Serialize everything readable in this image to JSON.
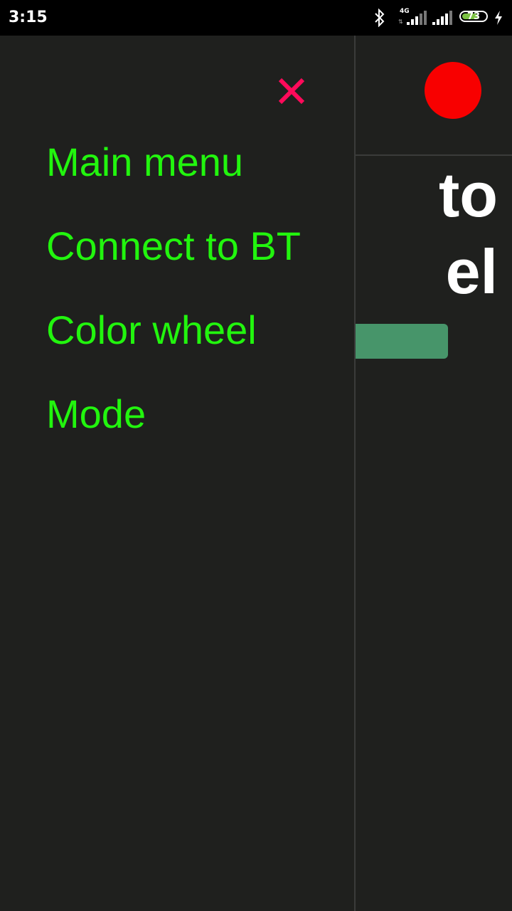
{
  "status_bar": {
    "time": "3:15",
    "network": "4G",
    "battery": "73",
    "battery_level_percent": 73,
    "battery_color": "#7cc243",
    "icons": [
      "bluetooth-icon",
      "signal-icon",
      "signal-icon",
      "battery-icon",
      "charging-icon"
    ]
  },
  "background": {
    "title_line1": "to",
    "title_line2": "el",
    "indicator_color": "#f80000",
    "button_color": "#47956a"
  },
  "drawer": {
    "close_icon": "close-icon",
    "close_color": "#ff0a5a",
    "text_color": "#22f50e",
    "items": [
      {
        "label": "Main menu"
      },
      {
        "label": "Connect to BT"
      },
      {
        "label": "Color wheel"
      },
      {
        "label": "Mode"
      }
    ]
  }
}
